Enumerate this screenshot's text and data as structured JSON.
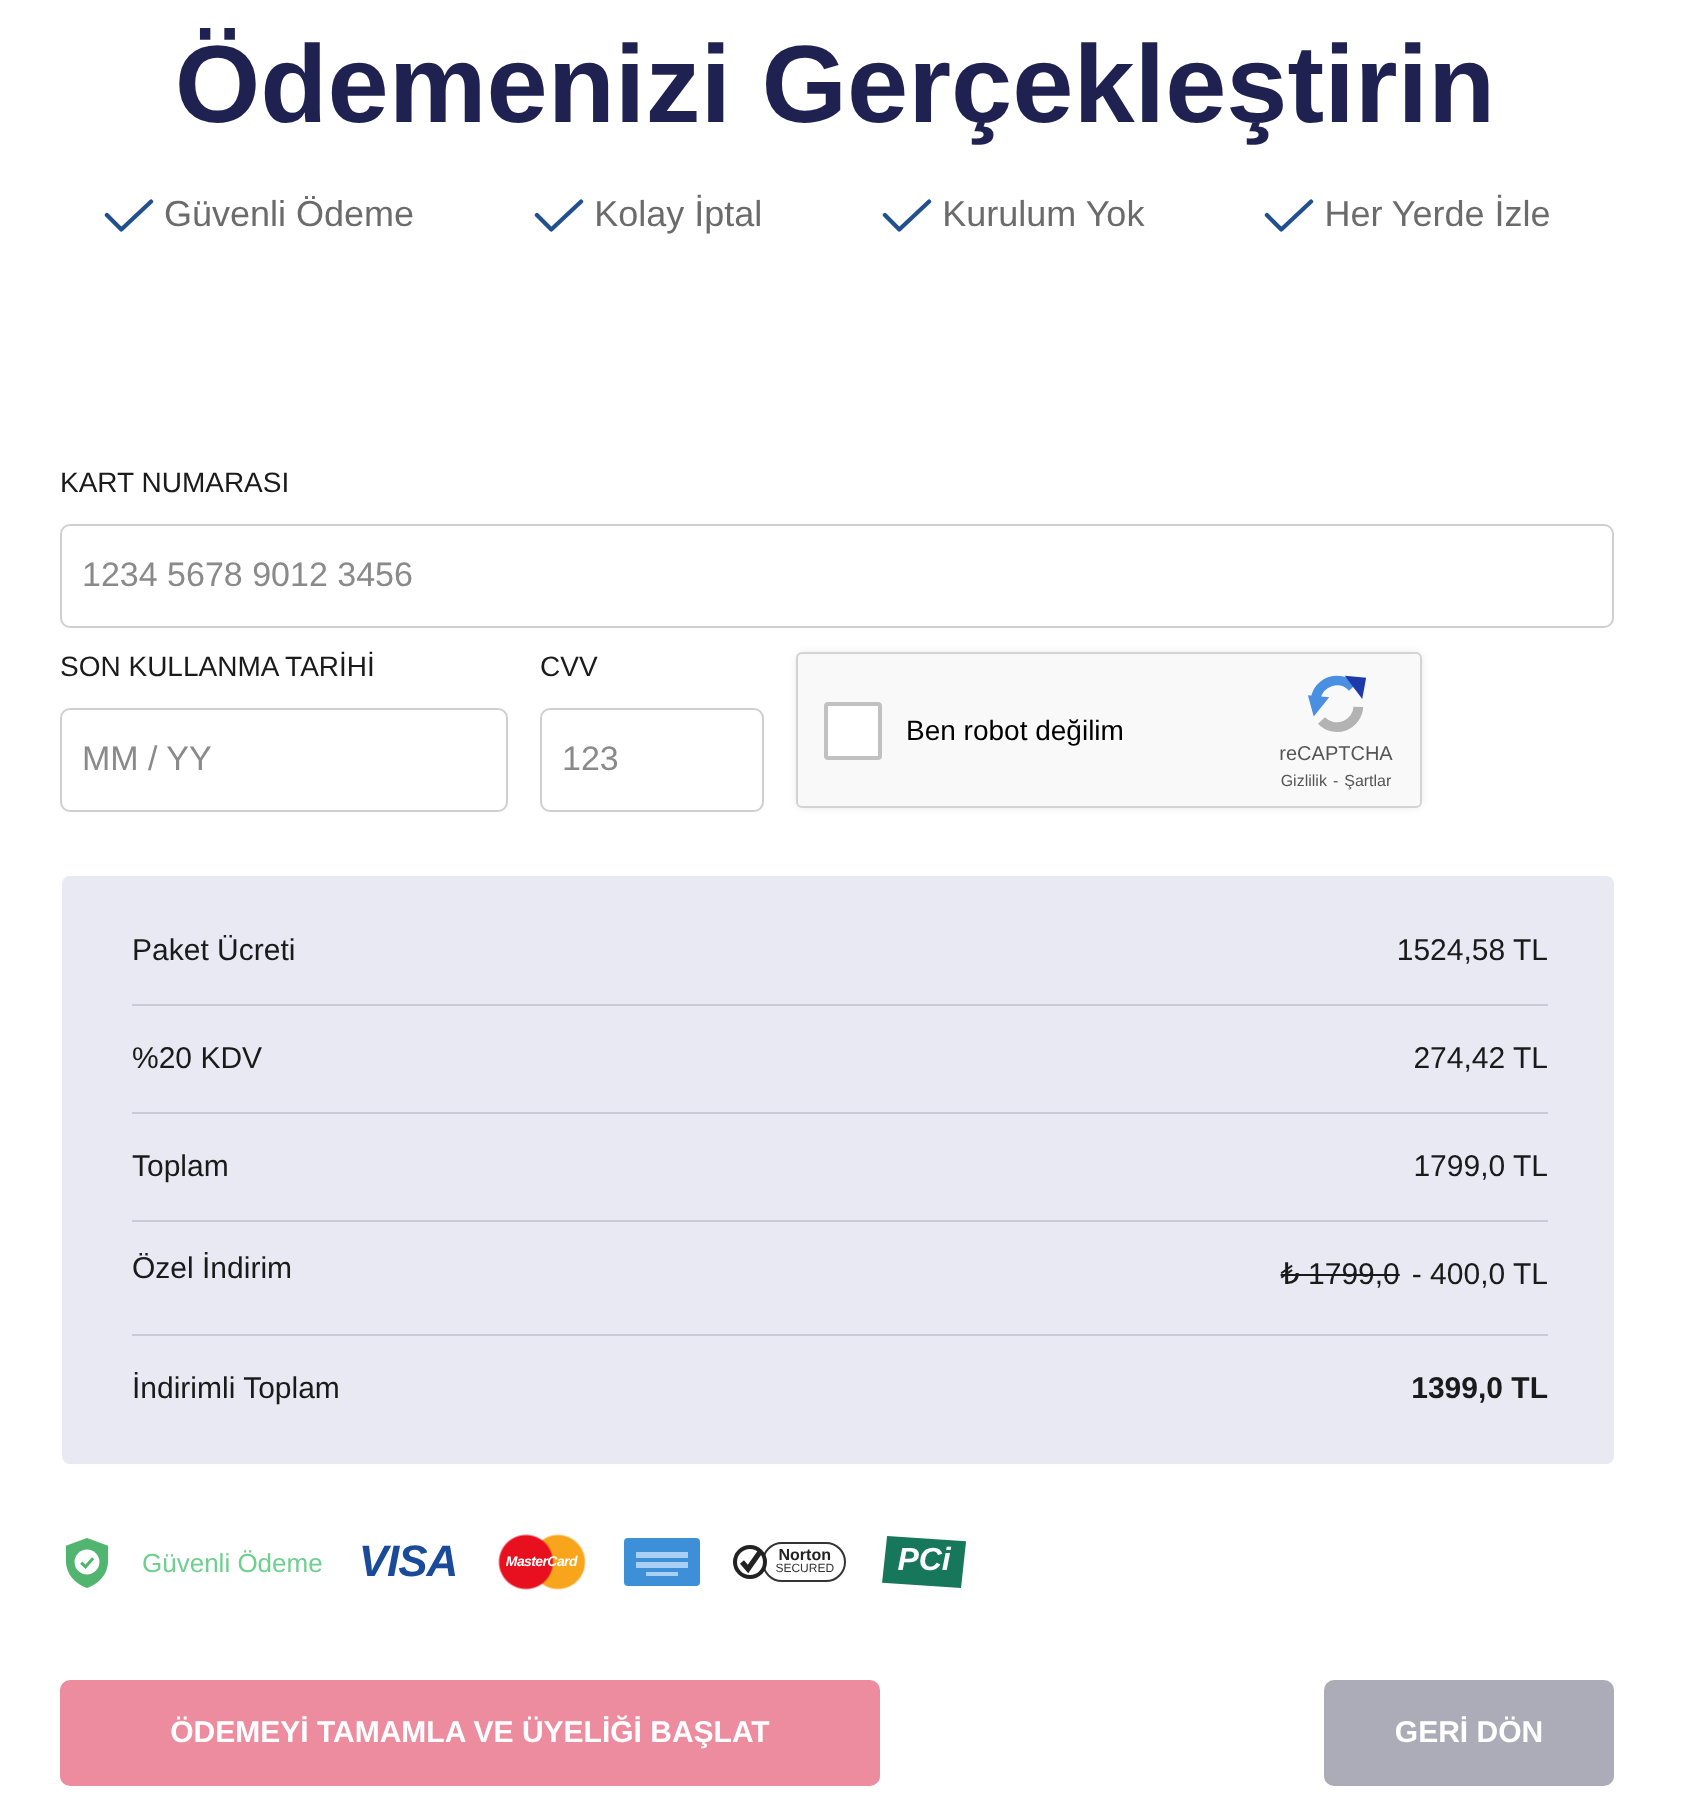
{
  "title": "Ödemenizi Gerçekleştirin",
  "features": [
    "Güvenli Ödeme",
    "Kolay İptal",
    "Kurulum Yok",
    "Her Yerde İzle"
  ],
  "card_form": {
    "card_number": {
      "label": "KART NUMARASI",
      "placeholder": "1234 5678 9012 3456"
    },
    "expiry": {
      "label": "SON KULLANMA TARİHİ",
      "placeholder": "MM / YY"
    },
    "cvv": {
      "label": "CVV",
      "placeholder": "123"
    }
  },
  "captcha": {
    "label": "Ben robot değilim",
    "checked": false,
    "brand": "reCAPTCHA",
    "privacy": "Gizlilik",
    "separator": "-",
    "terms": "Şartlar"
  },
  "summary": {
    "rows": [
      {
        "kind": "line",
        "label": "Paket Ücreti",
        "value": "1524,58 TL"
      },
      {
        "kind": "line",
        "label": "%20 KDV",
        "value": "274,42 TL"
      },
      {
        "kind": "line",
        "label": "Toplam",
        "value": "1799,0 TL"
      },
      {
        "kind": "discount",
        "label": "Özel İndirim",
        "old_value": "₺ 1799,0",
        "value": "- 400,0 TL"
      },
      {
        "kind": "total",
        "label": "İndirimli Toplam",
        "value": "1399,0 TL"
      }
    ]
  },
  "trust_badges": {
    "secure_label": "Güvenli Ödeme",
    "logos": [
      {
        "kind": "visa",
        "text": "VISA"
      },
      {
        "kind": "mastercard",
        "text": "MasterCard"
      },
      {
        "kind": "amex"
      },
      {
        "kind": "norton",
        "text": "Norton",
        "subtext": "SECURED"
      },
      {
        "kind": "pci",
        "text": "PCi"
      }
    ]
  },
  "buttons": [
    {
      "kind": "primary",
      "label": "ÖDEMEYİ TAMAMLA VE ÜYELİĞİ BAŞLAT"
    },
    {
      "kind": "secondary",
      "label": "GERİ DÖN"
    }
  ]
}
